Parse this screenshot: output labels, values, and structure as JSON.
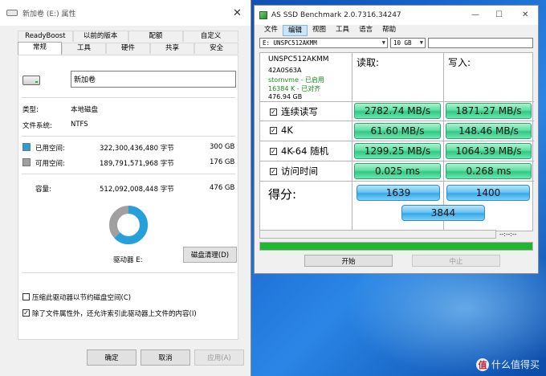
{
  "properties_window": {
    "title": "新加卷 (E:) 属性",
    "tabs_row1": [
      "ReadyBoost",
      "以前的版本",
      "配额",
      "自定义"
    ],
    "tabs_row2": [
      "常规",
      "工具",
      "硬件",
      "共享",
      "安全"
    ],
    "active_tab": "常规",
    "volume_name": "新加卷",
    "type_label": "类型:",
    "type_value": "本地磁盘",
    "fs_label": "文件系统:",
    "fs_value": "NTFS",
    "used_label": "已用空间:",
    "used_bytes": "322,300,436,480 字节",
    "used_size": "300 GB",
    "free_label": "可用空间:",
    "free_bytes": "189,791,571,968 字节",
    "free_size": "176 GB",
    "capacity_label": "容量:",
    "capacity_bytes": "512,092,008,448 字节",
    "capacity_size": "476 GB",
    "used_fraction": 0.63,
    "drive_label": "驱动器 E:",
    "cleanup_button": "磁盘清理(D)",
    "compress_label": "压缩此驱动器以节约磁盘空间(C)",
    "compress_checked": false,
    "index_label": "除了文件属性外，还允许索引此驱动器上文件的内容(I)",
    "index_checked": true,
    "ok_button": "确定",
    "cancel_button": "取消",
    "apply_button": "应用(A)",
    "colors": {
      "used": "#26a0da",
      "free": "#a0a0a0"
    }
  },
  "ssd_window": {
    "title": "AS SSD Benchmark 2.0.7316.34247",
    "menu": [
      "文件",
      "编辑",
      "视图",
      "工具",
      "语言",
      "帮助"
    ],
    "active_menu": "编辑",
    "drive_select": "E: UNSPC512AKMM",
    "size_select": "10 GB",
    "drive_info": {
      "model": "UNSPC512AKMM",
      "firmware": "42A0S63A",
      "driver": "stornvme - 已启用",
      "alignment": "16384 K - 已对齐",
      "size": "476.94 GB"
    },
    "read_header": "读取:",
    "write_header": "写入:",
    "tests": [
      {
        "label": "连续读写",
        "read": "2782.74 MB/s",
        "write": "1871.27 MB/s"
      },
      {
        "label": "4K",
        "read": "61.60 MB/s",
        "write": "148.46 MB/s"
      },
      {
        "label": "4K-64 随机",
        "read": "1299.25 MB/s",
        "write": "1064.39 MB/s"
      },
      {
        "label": "访问时间",
        "read": "0.025 ms",
        "write": "0.268 ms"
      }
    ],
    "score_label": "得分:",
    "score_read": "1639",
    "score_write": "1400",
    "score_total": "3844",
    "time_display": "--:--:--",
    "progress_fraction": 1.0,
    "start_button": "开始",
    "stop_button": "中止",
    "colors": {
      "result": "#45d896",
      "score": "#3fb0ea",
      "progress": "#22b532"
    }
  },
  "watermark": {
    "badge": "值",
    "text": "什么值得买"
  }
}
